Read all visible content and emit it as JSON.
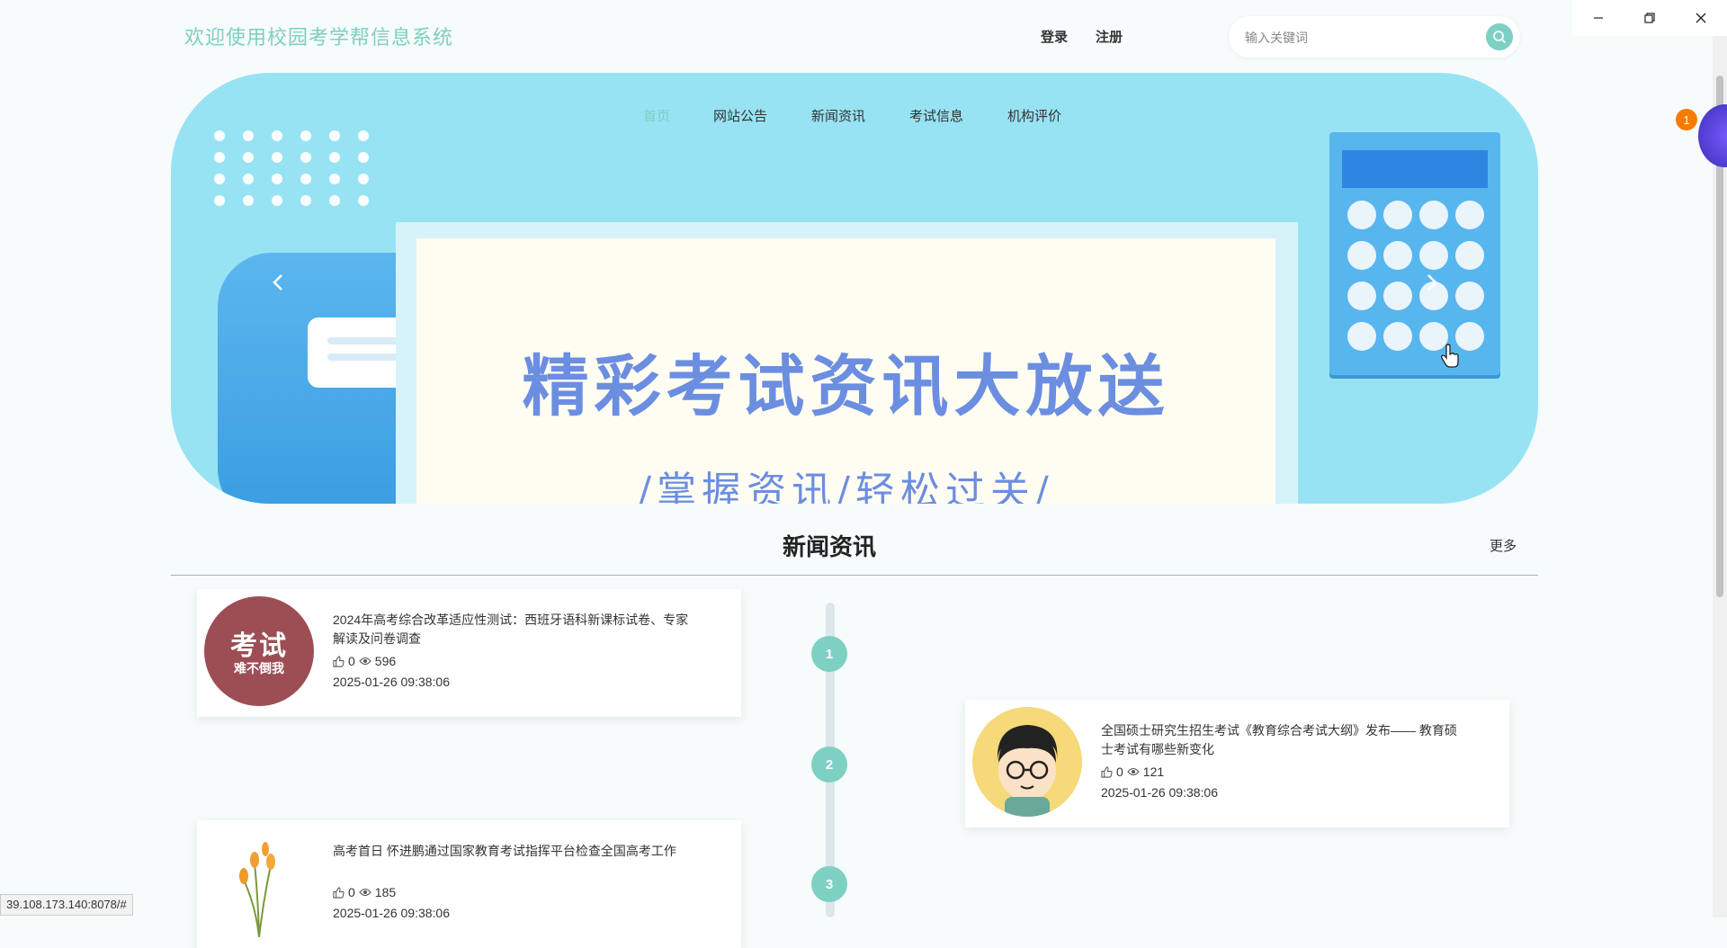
{
  "header": {
    "site_title": "欢迎使用校园考学帮信息系统",
    "login": "登录",
    "register": "注册",
    "search_placeholder": "输入关键词"
  },
  "nav": {
    "items": [
      {
        "label": "首页",
        "active": true
      },
      {
        "label": "网站公告",
        "active": false
      },
      {
        "label": "新闻资讯",
        "active": false
      },
      {
        "label": "考试信息",
        "active": false
      },
      {
        "label": "机构评价",
        "active": false
      }
    ]
  },
  "banner": {
    "title": "精彩考试资讯大放送",
    "subtitle": "/掌握资讯/轻松过关/"
  },
  "news_section": {
    "title": "新闻资讯",
    "more": "更多",
    "items": [
      {
        "index": "1",
        "thumb_big": "考试",
        "thumb_small": "难不倒我",
        "title": "2024年高考综合改革适应性测试：西班牙语科新课标试卷、专家解读及问卷调查",
        "likes": "0",
        "views": "596",
        "date": "2025-01-26 09:38:06"
      },
      {
        "index": "2",
        "title": "全国硕士研究生招生考试《教育综合考试大纲》发布—— 教育硕士考试有哪些新变化",
        "likes": "0",
        "views": "121",
        "date": "2025-01-26 09:38:06"
      },
      {
        "index": "3",
        "title": "高考首日 怀进鹏通过国家教育考试指挥平台检查全国高考工作",
        "likes": "0",
        "views": "185",
        "date": "2025-01-26 09:38:06"
      }
    ]
  },
  "status_bar": {
    "url": "39.108.173.140:8078/#"
  },
  "floating": {
    "badge": "1"
  },
  "colors": {
    "accent": "#7ed0c3",
    "banner_bg": "#97e3f3",
    "poster_text": "#6c8ee0"
  }
}
